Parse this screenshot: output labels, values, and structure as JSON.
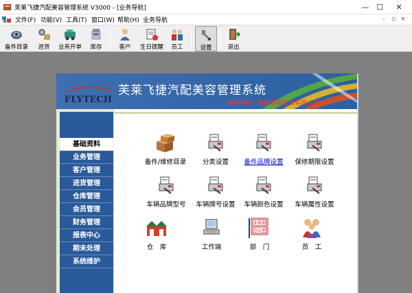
{
  "window": {
    "title": "芙莱飞捷汽配美容管理系统 V3000 - [业务导航]",
    "minimize_glyph": "—",
    "maximize_glyph": "☐",
    "close_glyph": "✕"
  },
  "menu": {
    "items": [
      "文件(F)",
      "功能(V)",
      "工具(T)",
      "窗口(W)",
      "帮助(H)",
      "业务导航"
    ],
    "mdi_min": "-",
    "mdi_restore": "▫",
    "mdi_close": "×"
  },
  "toolbar": {
    "buttons": [
      {
        "label": "备件目录",
        "icon": "parts-catalog-icon"
      },
      {
        "label": "进货",
        "icon": "purchase-icon"
      },
      {
        "label": "业务开单",
        "icon": "business-order-icon"
      },
      {
        "label": "库存",
        "icon": "inventory-icon"
      },
      {
        "label": "客户",
        "icon": "customer-icon"
      },
      {
        "label": "生日提醒",
        "icon": "birthday-reminder-icon"
      },
      {
        "label": "员工",
        "icon": "employee-icon"
      },
      {
        "label": "设置",
        "icon": "settings-icon"
      },
      {
        "label": "退出",
        "icon": "exit-icon"
      }
    ]
  },
  "banner": {
    "title": "芙莱飞捷汽配美容管理系统",
    "subtitle": "版权所有：湘西美容商贸有限公司",
    "logo_text": "FLYTECH"
  },
  "nav": {
    "items": [
      "基础资料",
      "业务管理",
      "客户管理",
      "进货管理",
      "仓库管理",
      "会员管理",
      "财务管理",
      "报表中心",
      "期末处理",
      "系统维护"
    ],
    "active_index": 0
  },
  "tiles": [
    {
      "label": "备件/维修目录",
      "icon": "boxes-icon"
    },
    {
      "label": "分类设置",
      "icon": "printer-settings-icon"
    },
    {
      "label": "备件品牌设置",
      "icon": "printer-settings-icon",
      "link": true
    },
    {
      "label": "保修期限设置",
      "icon": "printer-settings-icon"
    },
    {
      "label": "车辆品牌型号",
      "icon": "printer-settings-icon"
    },
    {
      "label": "车辆牌号设置",
      "icon": "printer-settings-icon"
    },
    {
      "label": "车辆颜色设置",
      "icon": "printer-settings-icon"
    },
    {
      "label": "车辆属性设置",
      "icon": "printer-settings-icon"
    },
    {
      "label": "仓　库",
      "icon": "warehouse-icon"
    },
    {
      "label": "工作端",
      "icon": "terminal-icon"
    },
    {
      "label": "部　门",
      "icon": "department-icon"
    },
    {
      "label": "员　工",
      "icon": "staff-icon"
    }
  ],
  "dept_sign": {
    "line1": "业务部",
    "line2": "办公室"
  },
  "colors": {
    "accent": "#2a5a9a",
    "link": "#0000cc",
    "banner_sub": "#ff3030"
  }
}
